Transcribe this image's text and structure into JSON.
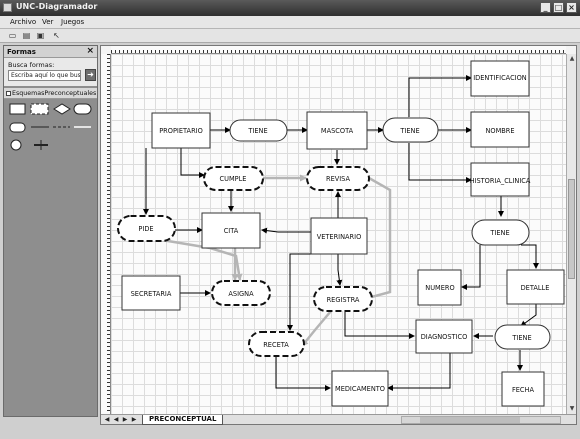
{
  "window": {
    "title": "UNC-Diagramador"
  },
  "menu": [
    "Archivo",
    "Ver",
    "Juegos"
  ],
  "formas": {
    "title": "Formas",
    "search_label": "Busca formas:",
    "search_value": "Escriba aquí lo que bus"
  },
  "stencil": {
    "title": "EsquemasPreconceptuales"
  },
  "page_tab": "PRECONCEPTUAL",
  "diagram": {
    "propietario": "PROPIETARIO",
    "tiene1": "TIENE",
    "mascota": "MASCOTA",
    "tiene2": "TIENE",
    "identificacion": "IDENTIFICACION",
    "nombre": "NOMBRE",
    "historia": "HISTORIA_CLINICA",
    "cumple": "CUMPLE",
    "revisa": "REVISA",
    "pide": "PIDE",
    "cita": "CITA",
    "veterinario": "VETERINARIO",
    "tiene3": "TIENE",
    "secretaria": "SECRETARIA",
    "asigna": "ASIGNA",
    "registra": "REGISTRA",
    "numero": "NUMERO",
    "detalle": "DETALLE",
    "receta": "RECETA",
    "diagnostico": "DIAGNOSTICO",
    "tiene4": "TIENE",
    "medicamento": "MEDICAMENTO",
    "fecha": "FECHA"
  }
}
